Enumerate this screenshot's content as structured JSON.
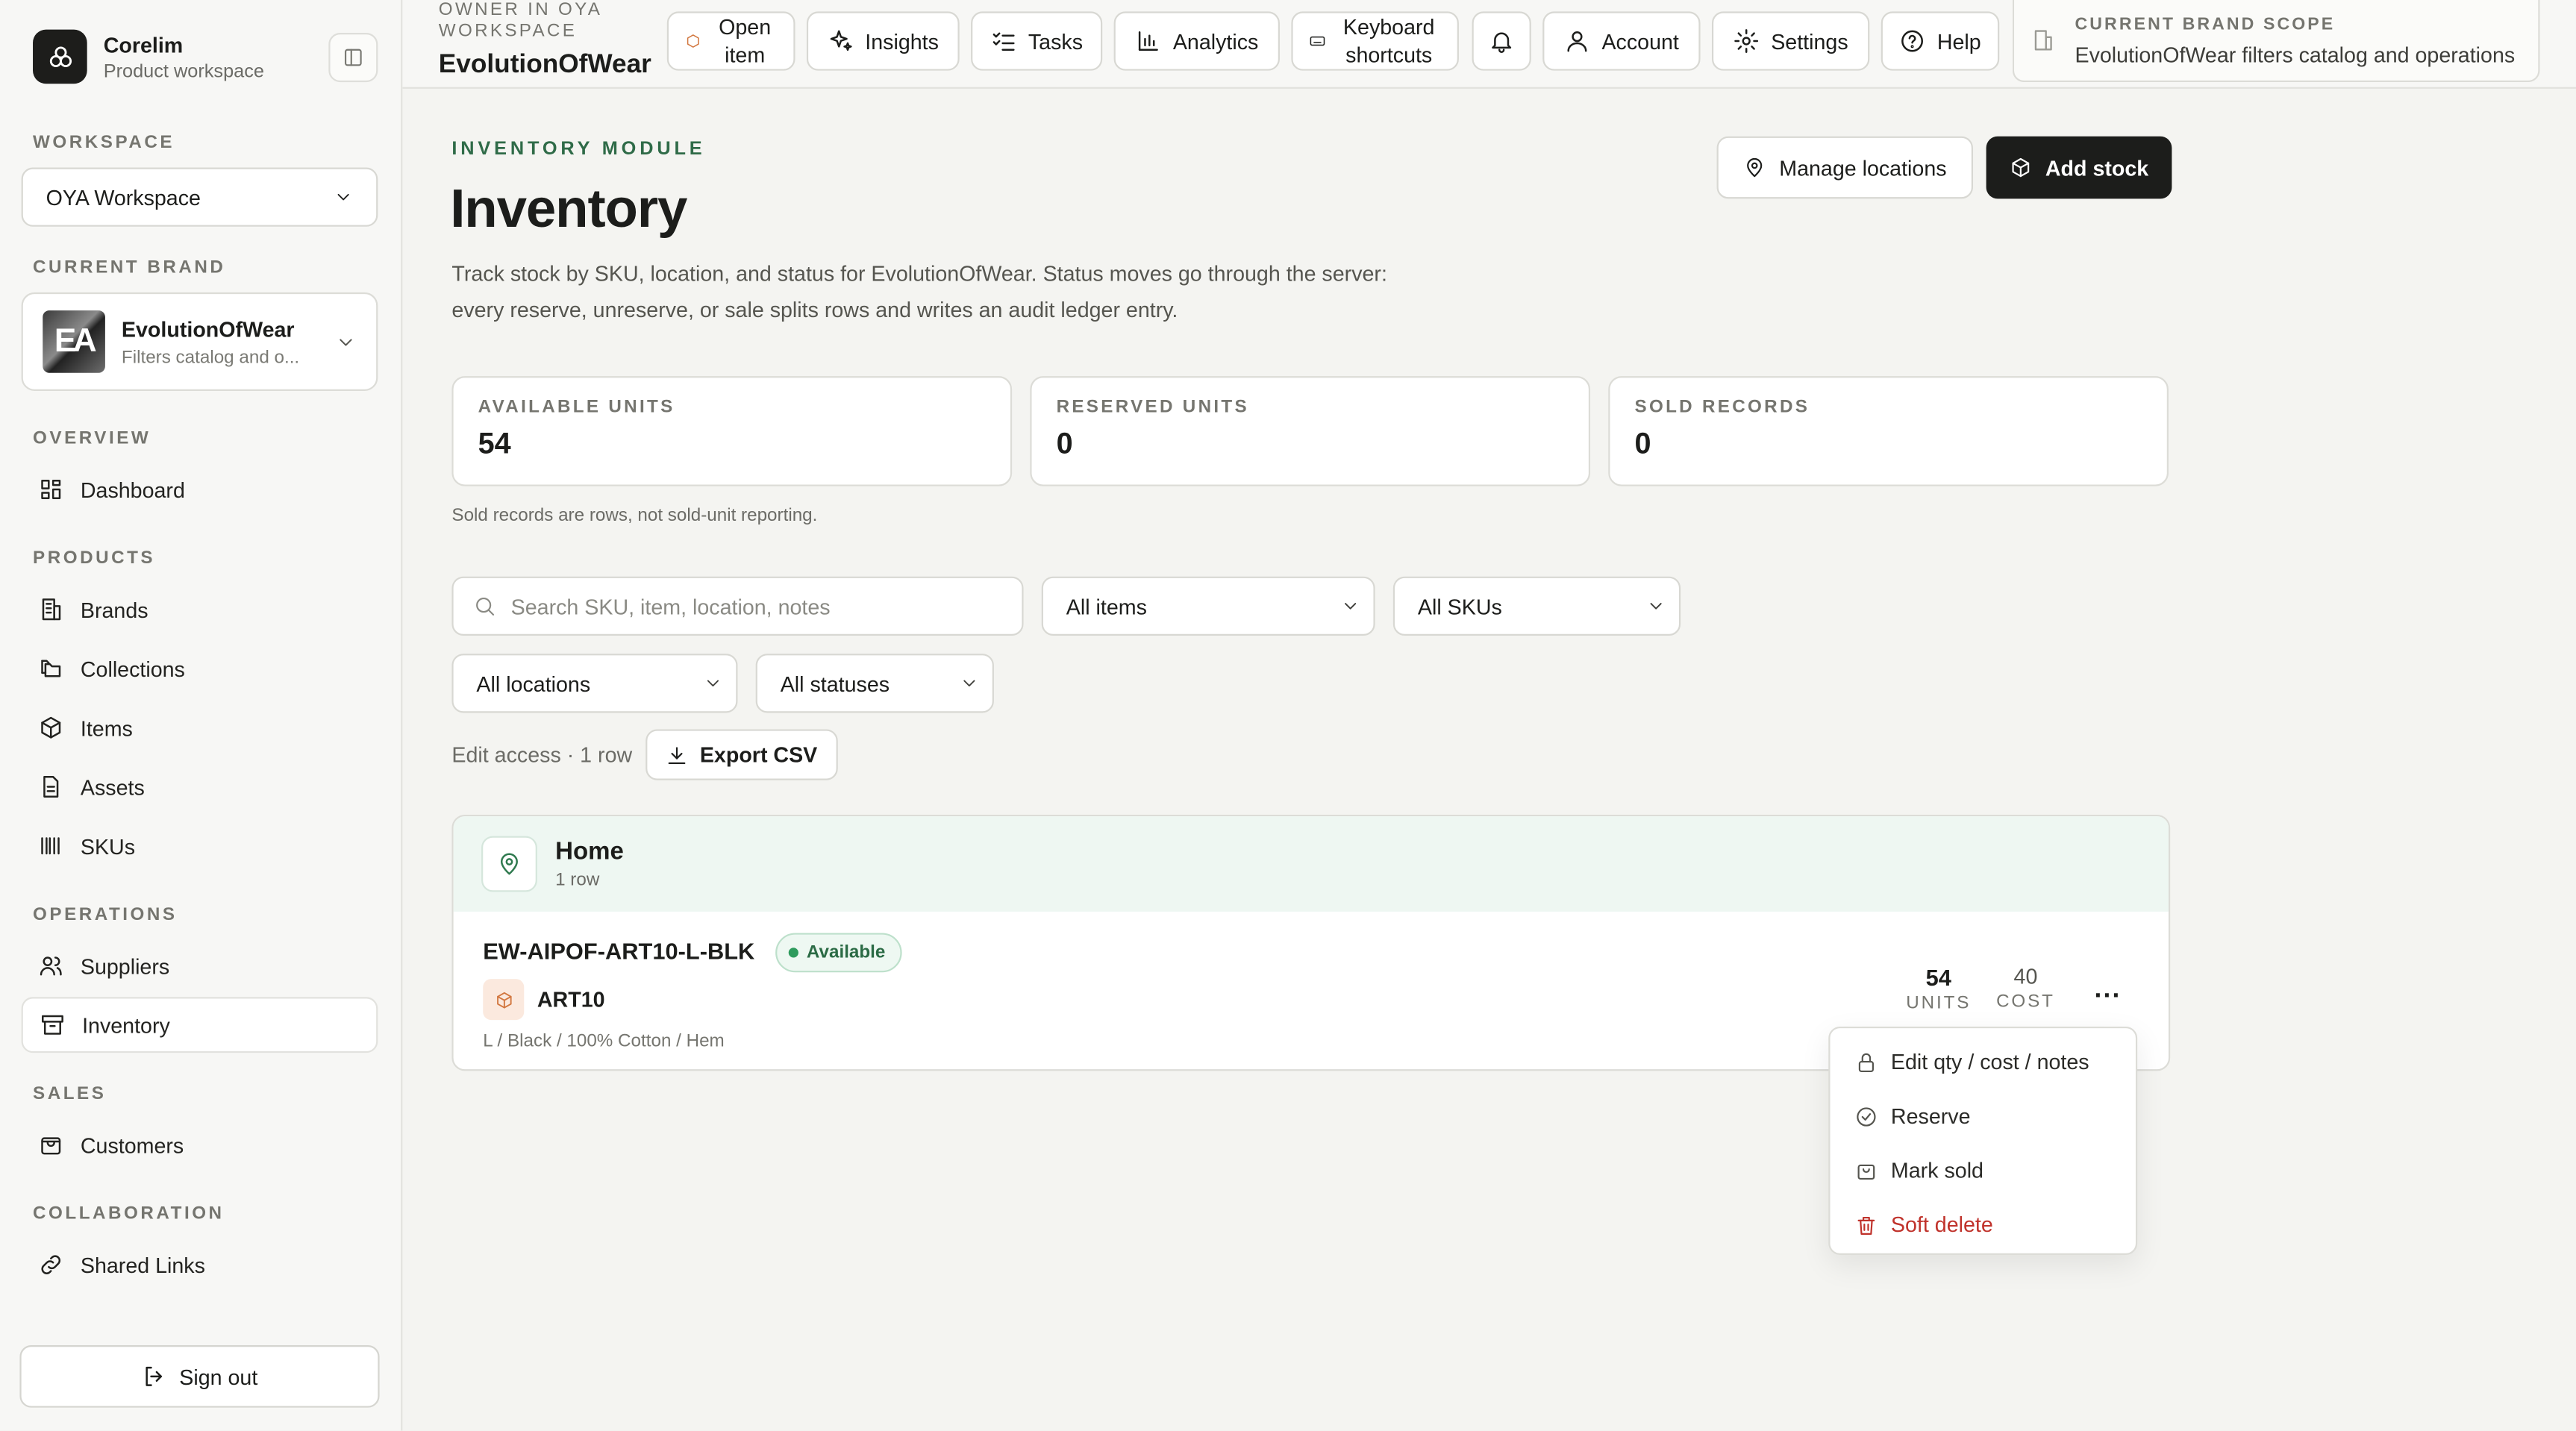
{
  "app": {
    "name": "Corelim",
    "subtitle": "Product workspace"
  },
  "sidebar": {
    "workspace_label": "WORKSPACE",
    "workspace_value": "OYA Workspace",
    "brand_label": "CURRENT BRAND",
    "brand": {
      "logo_text": "EA",
      "name": "EvolutionOfWear",
      "desc": "Filters catalog and o..."
    },
    "sections": {
      "overview": "OVERVIEW",
      "products": "PRODUCTS",
      "operations": "OPERATIONS",
      "sales": "SALES",
      "collaboration": "COLLABORATION"
    },
    "items": {
      "dashboard": "Dashboard",
      "brands": "Brands",
      "collections": "Collections",
      "items": "Items",
      "assets": "Assets",
      "skus": "SKUs",
      "suppliers": "Suppliers",
      "inventory": "Inventory",
      "customers": "Customers",
      "shared_links": "Shared Links"
    },
    "sign_out": "Sign out"
  },
  "topbar": {
    "owner_label": "OWNER IN OYA WORKSPACE",
    "owner_name": "EvolutionOfWear",
    "open_item": "Open item",
    "insights": "Insights",
    "tasks": "Tasks",
    "analytics": "Analytics",
    "keyboard_shortcuts": "Keyboard shortcuts",
    "account": "Account",
    "settings": "Settings",
    "help": "Help",
    "scope_label": "CURRENT BRAND SCOPE",
    "scope_value": "EvolutionOfWear filters catalog and operations"
  },
  "page": {
    "eyebrow": "INVENTORY MODULE",
    "title": "Inventory",
    "description": "Track stock by SKU, location, and status for EvolutionOfWear. Status moves go through the server: every reserve, unreserve, or sale splits rows and writes an audit ledger entry.",
    "manage_locations": "Manage locations",
    "add_stock": "Add stock"
  },
  "stats": [
    {
      "label": "AVAILABLE UNITS",
      "value": "54"
    },
    {
      "label": "RESERVED UNITS",
      "value": "0"
    },
    {
      "label": "SOLD RECORDS",
      "value": "0"
    }
  ],
  "stats_note": "Sold records are rows, not sold-unit reporting.",
  "filters": {
    "search_placeholder": "Search SKU, item, location, notes",
    "items": "All items",
    "skus": "All SKUs",
    "locations": "All locations",
    "statuses": "All statuses"
  },
  "access_text": "Edit access · 1 row",
  "export_csv": "Export CSV",
  "group": {
    "name": "Home",
    "count": "1 row",
    "row": {
      "sku": "EW-AIPOF-ART10-L-BLK",
      "status": "Available",
      "item": "ART10",
      "variant": "L / Black / 100% Cotton / Hem",
      "units": "54",
      "units_label": "UNITS",
      "cost": "40",
      "cost_label": "COST",
      "more": "..."
    }
  },
  "row_menu": {
    "edit": "Edit qty / cost / notes",
    "reserve": "Reserve",
    "mark_sold": "Mark sold",
    "soft_delete": "Soft delete"
  },
  "colors": {
    "accent_green": "#2f6b48",
    "danger": "#c0322b",
    "dark_button": "#1c1d1b"
  }
}
